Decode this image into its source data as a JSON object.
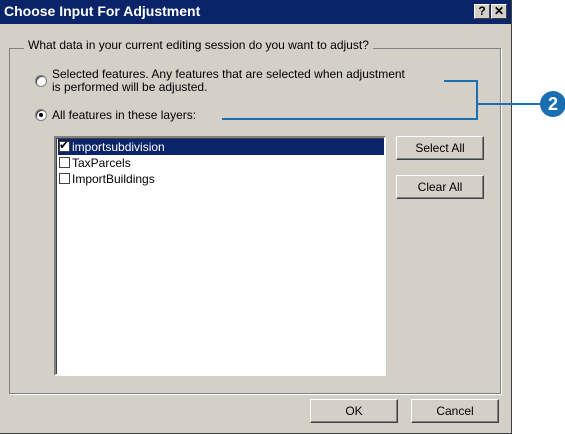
{
  "window": {
    "title": "Choose Input For Adjustment",
    "help_label": "?",
    "close_label": "✕"
  },
  "group": {
    "legend": "What data in your current editing session do you want to adjust?"
  },
  "options": {
    "selected_line1": "Selected features.  Any features that are selected when adjustment",
    "selected_line2": "is performed will be adjusted.",
    "all_layers": "All features in these layers:",
    "checked": "all_layers"
  },
  "layers": [
    {
      "name": "importsubdivision",
      "checked": true,
      "selected": true
    },
    {
      "name": "TaxParcels",
      "checked": false,
      "selected": false
    },
    {
      "name": "ImportBuildings",
      "checked": false,
      "selected": false
    }
  ],
  "buttons": {
    "select_all": "Select All",
    "clear_all": "Clear All",
    "ok": "OK",
    "cancel": "Cancel"
  },
  "callout": {
    "number": "2",
    "color": "#1a6fb3"
  },
  "colors": {
    "titlebar": "#0a246a",
    "dialog": "#d4d0c8",
    "selection": "#0a246a"
  }
}
